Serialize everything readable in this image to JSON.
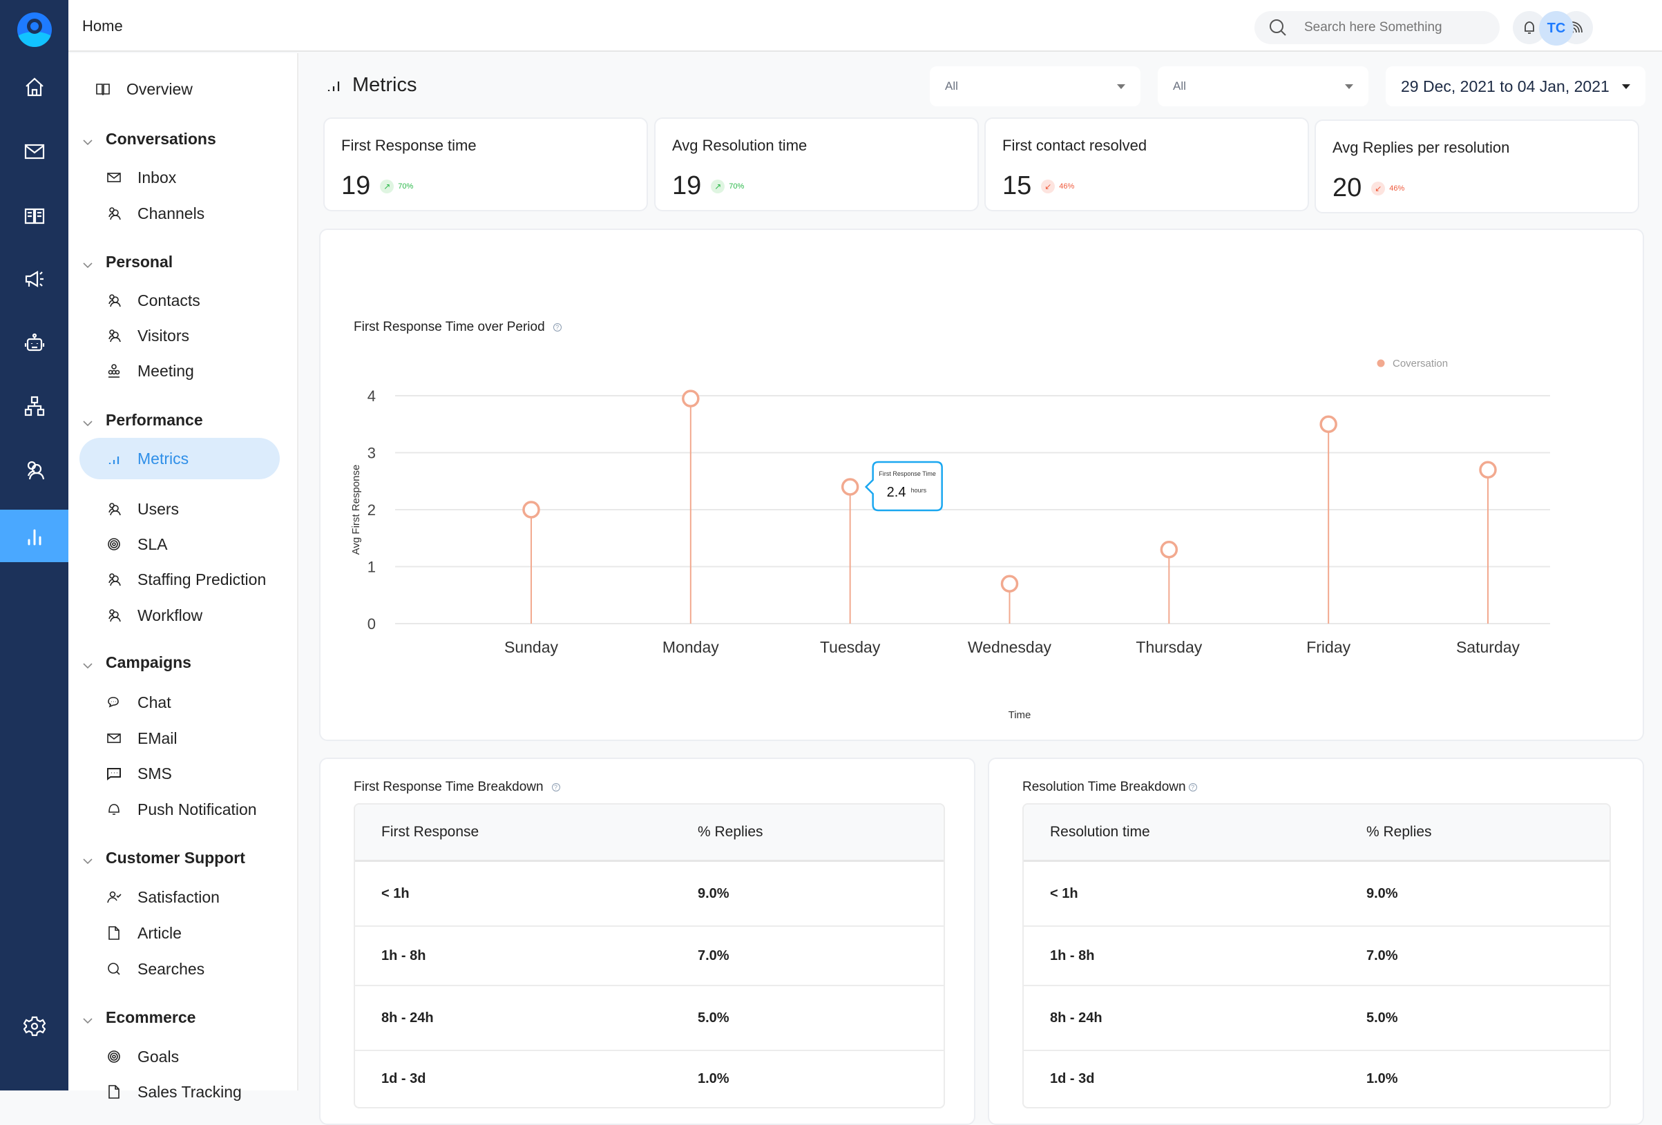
{
  "header": {
    "breadcrumb": "Home",
    "search_placeholder": "Search here Something",
    "avatar_initials": "TC"
  },
  "rail": {
    "items": [
      "home",
      "mail",
      "knowledge-base",
      "campaigns",
      "bot",
      "hierarchy",
      "users",
      "analytics"
    ],
    "active": "analytics",
    "settings": "settings"
  },
  "nav": {
    "overview": "Overview",
    "sections": [
      {
        "title": "Conversations",
        "items": [
          "Inbox",
          "Channels"
        ]
      },
      {
        "title": "Personal",
        "items": [
          "Contacts",
          "Visitors",
          "Meeting"
        ]
      },
      {
        "title": "Performance",
        "items": [
          "Metrics",
          "Users",
          "SLA",
          "Staffing Prediction",
          "Workflow"
        ]
      },
      {
        "title": "Campaigns",
        "items": [
          "Chat",
          "EMail",
          "SMS",
          "Push Notification"
        ]
      },
      {
        "title": "Customer Support",
        "items": [
          "Satisfaction",
          "Article",
          "Searches"
        ]
      },
      {
        "title": "Ecommerce",
        "items": [
          "Goals",
          "Sales Tracking"
        ]
      }
    ],
    "active_item": "Metrics"
  },
  "main": {
    "title": "Metrics",
    "filters": [
      {
        "value": "All"
      },
      {
        "value": "All"
      }
    ],
    "date_range": "29 Dec, 2021 to 04 Jan, 2021",
    "kpis": [
      {
        "label": "First Response time",
        "value": "19",
        "change": "70%",
        "direction": "up"
      },
      {
        "label": "Avg Resolution time",
        "value": "19",
        "change": "70%",
        "direction": "up"
      },
      {
        "label": "First contact resolved",
        "value": "15",
        "change": "46%",
        "direction": "down"
      },
      {
        "label": "Avg Replies per resolution",
        "value": "20",
        "change": "46%",
        "direction": "down"
      }
    ],
    "frt_breakdown": {
      "title": "First Response Time Breakdown",
      "columns": [
        "First Response",
        "% Replies"
      ],
      "rows": [
        [
          "< 1h",
          "9.0%"
        ],
        [
          "1h - 8h",
          "7.0%"
        ],
        [
          "8h - 24h",
          "5.0%"
        ],
        [
          "1d - 3d",
          "1.0%"
        ]
      ]
    },
    "rt_breakdown": {
      "title": "Resolution Time Breakdown",
      "columns": [
        "Resolution time",
        "% Replies"
      ],
      "rows": [
        [
          "< 1h",
          "9.0%"
        ],
        [
          "1h - 8h",
          "7.0%"
        ],
        [
          "8h - 24h",
          "5.0%"
        ],
        [
          "1d - 3d",
          "1.0%"
        ]
      ]
    }
  },
  "chart_data": {
    "type": "scatter",
    "style": "lollipop",
    "title": "First Response Time over Period",
    "xlabel": "Time",
    "ylabel": "Avg First Response",
    "categories": [
      "Sunday",
      "Monday",
      "Tuesday",
      "Wednesday",
      "Thursday",
      "Friday",
      "Saturday"
    ],
    "series": [
      {
        "name": "Coversation",
        "color": "#f2a98f",
        "values": [
          2.0,
          3.95,
          2.4,
          0.7,
          1.3,
          3.5,
          2.7
        ]
      }
    ],
    "yticks": [
      0,
      1,
      2,
      3,
      4
    ],
    "ylim": [
      0,
      4
    ],
    "grid": true,
    "legend": "top-right",
    "tooltip": {
      "category": "Tuesday",
      "label": "First Response Time",
      "value": "2.4",
      "unit": "hours",
      "border_color": "#1aa7f0"
    }
  }
}
